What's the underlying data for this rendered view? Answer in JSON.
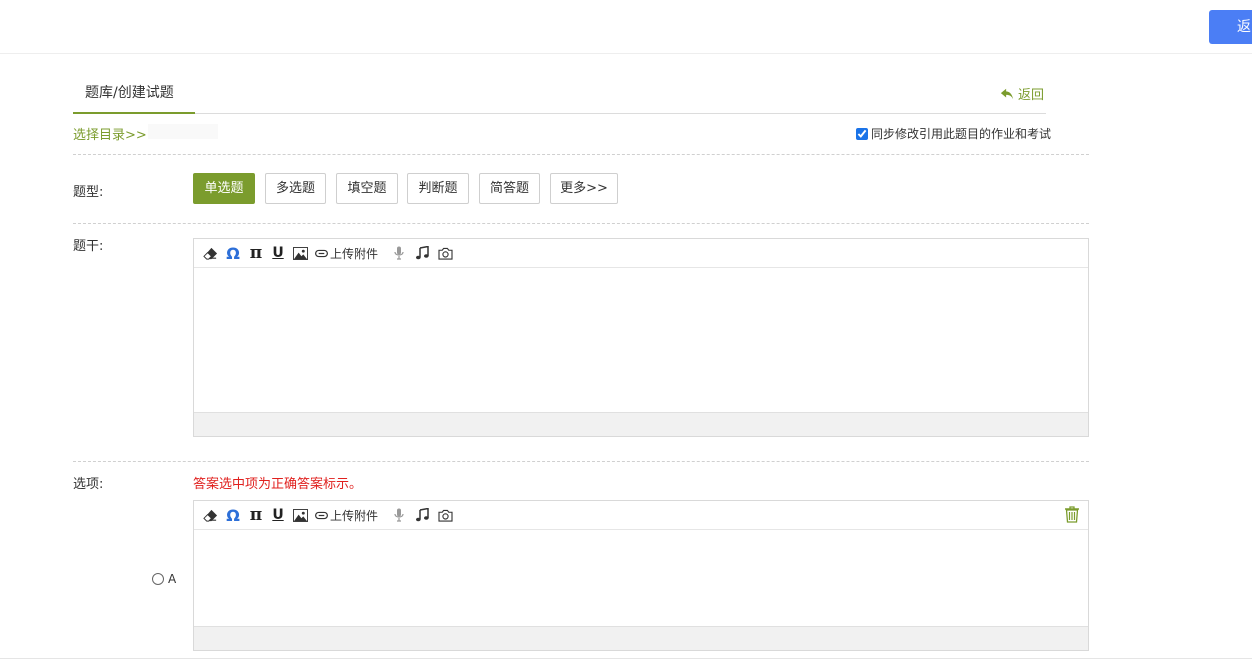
{
  "topbar": {
    "back_label": "返回"
  },
  "breadcrumb": {
    "text": "题库/创建试题"
  },
  "back_link": {
    "label": "返回"
  },
  "select_dir": {
    "label": "选择目录>>"
  },
  "sync": {
    "label": "同步修改引用此题目的作业和考试",
    "checked": true
  },
  "question_type": {
    "label": "题型:",
    "types": [
      "单选题",
      "多选题",
      "填空题",
      "判断题",
      "简答题",
      "更多>>"
    ],
    "selected": "单选题"
  },
  "stem": {
    "label": "题干:"
  },
  "editor_toolbar": {
    "upload_label": "上传附件",
    "icons": [
      "eraser-icon",
      "omega-icon",
      "pi-icon",
      "underline-icon",
      "image-icon",
      "attachment-icon",
      "microphone-icon",
      "music-icon",
      "camera-icon"
    ]
  },
  "options": {
    "label": "选项:",
    "hint": "答案选中项为正确答案标示。",
    "items": [
      {
        "letter": "A"
      }
    ]
  },
  "colors": {
    "accent": "#7b9c2d",
    "primary_button": "#4b7ef5",
    "hint_red": "#e0201e",
    "omega_blue": "#2d6fd8"
  }
}
